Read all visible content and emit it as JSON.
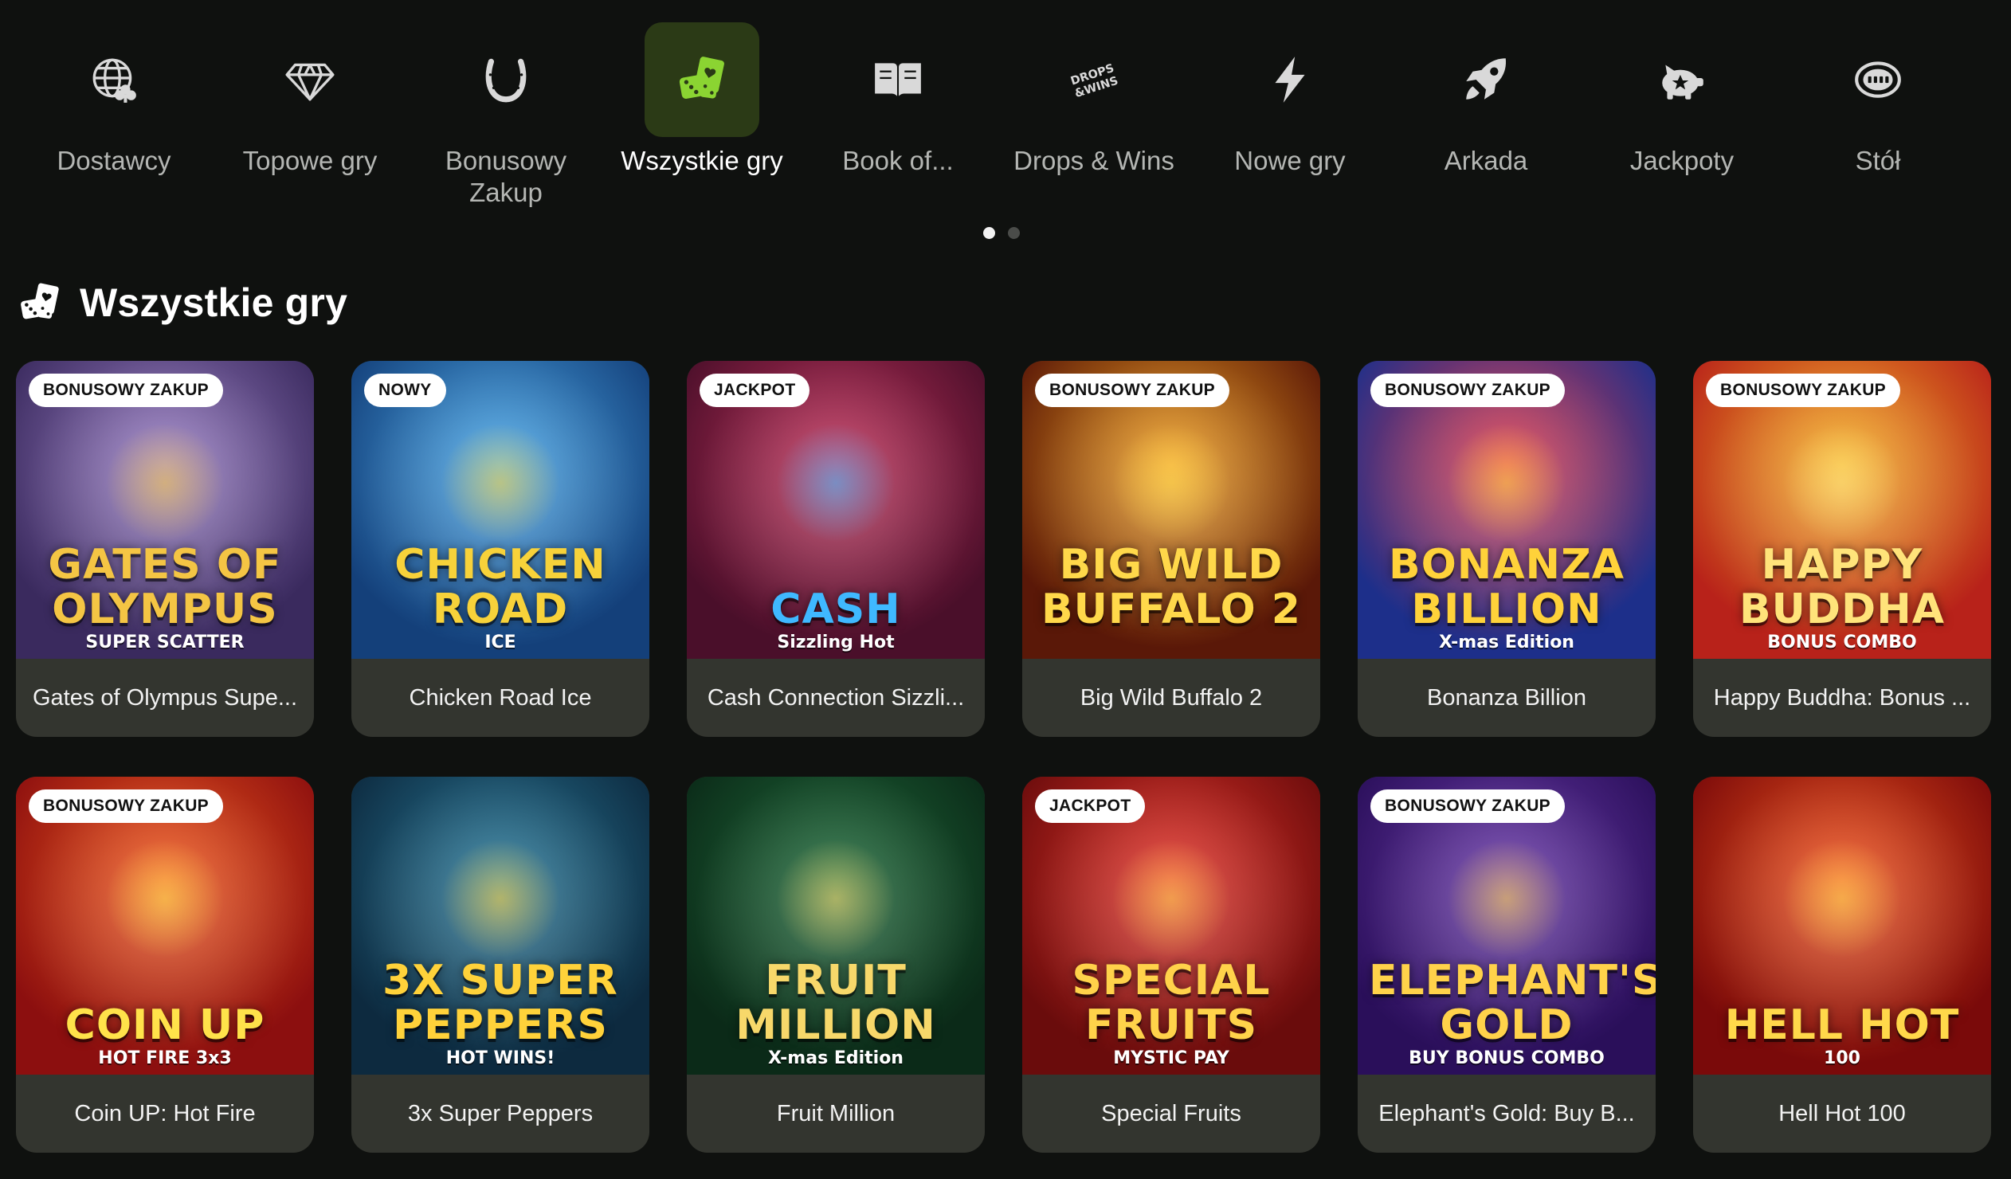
{
  "categories": [
    {
      "label": "Dostawcy",
      "icon": "globe-clubs-icon",
      "active": false
    },
    {
      "label": "Topowe gry",
      "icon": "diamond-icon",
      "active": false
    },
    {
      "label": "Bonusowy\nZakup",
      "icon": "horseshoe-icon",
      "active": false
    },
    {
      "label": "Wszystkie gry",
      "icon": "cards-dice-icon",
      "active": true
    },
    {
      "label": "Book of...",
      "icon": "book-icon",
      "active": false
    },
    {
      "label": "Drops & Wins",
      "icon": "drops-wins-icon",
      "active": false
    },
    {
      "label": "Nowe gry",
      "icon": "lightning-icon",
      "active": false
    },
    {
      "label": "Arkada",
      "icon": "rocket-icon",
      "active": false
    },
    {
      "label": "Jackpoty",
      "icon": "piggy-bank-icon",
      "active": false
    },
    {
      "label": "Stół",
      "icon": "table-icon",
      "active": false
    }
  ],
  "pagination": {
    "pages": 2,
    "current": 1
  },
  "section": {
    "title": "Wszystkie gry",
    "icon": "cards-dice-icon"
  },
  "colors": {
    "accent": "#8bd432",
    "active_bg": "#2b3a16",
    "background": "#0f110f",
    "card_footer": "#33352f"
  },
  "games": [
    {
      "name": "Gates of Olympus Supe...",
      "badge": "BONUSOWY ZAKUP",
      "art_text": "Gates of\nOlympus",
      "art_sub": "SUPER SCATTER",
      "bg1": "#9a7fc4",
      "bg2": "#3a2a5e",
      "text_color": "#f4c544"
    },
    {
      "name": "Chicken Road Ice",
      "badge": "NOWY",
      "art_text": "Chicken\nRoad",
      "art_sub": "ICE",
      "bg1": "#4aa8e8",
      "bg2": "#14407a",
      "text_color": "#f7d23a"
    },
    {
      "name": "Cash Connection Sizzli...",
      "badge": "JACKPOT",
      "art_text": "Cash",
      "art_sub": "Sizzling Hot",
      "bg1": "#c0315a",
      "bg2": "#4a0f2a",
      "text_color": "#3fb8ff"
    },
    {
      "name": "Big Wild Buffalo 2",
      "badge": "BONUSOWY ZAKUP",
      "art_text": "Big Wild\nBuffalo 2",
      "art_sub": "",
      "bg1": "#f0a020",
      "bg2": "#5a1808",
      "text_color": "#ffd84a"
    },
    {
      "name": "Bonanza Billion",
      "badge": "BONUSOWY ZAKUP",
      "art_text": "Bonanza\nBillion",
      "art_sub": "X-mas Edition",
      "bg1": "#e23a4a",
      "bg2": "#1d2f8a",
      "text_color": "#ffd23a"
    },
    {
      "name": "Happy Buddha: Bonus ...",
      "badge": "BONUSOWY ZAKUP",
      "art_text": "Happy\nBuddha",
      "art_sub": "BONUS COMBO",
      "bg1": "#f5b324",
      "bg2": "#b8221a",
      "text_color": "#ffe37a"
    },
    {
      "name": "Coin UP: Hot Fire",
      "badge": "BONUSOWY ZAKUP",
      "art_text": "Coin Up",
      "art_sub": "HOT FIRE 3x3",
      "bg1": "#f05a1e",
      "bg2": "#8c0f0f",
      "text_color": "#ffe24a"
    },
    {
      "name": "3x Super Peppers",
      "badge": "",
      "art_text": "3x Super\nPeppers",
      "art_sub": "HOT WINS!",
      "bg1": "#2a7a9a",
      "bg2": "#0d2a3f",
      "text_color": "#ffd23a"
    },
    {
      "name": "Fruit Million",
      "badge": "",
      "art_text": "Fruit\nMillion",
      "art_sub": "X-mas Edition",
      "bg1": "#1f6a3a",
      "bg2": "#0b2a18",
      "text_color": "#f7d86a"
    },
    {
      "name": "Special Fruits",
      "badge": "JACKPOT",
      "art_text": "Special\nFruits",
      "art_sub": "MYSTIC PAY",
      "bg1": "#e4342a",
      "bg2": "#6a0c0c",
      "text_color": "#ffd24a"
    },
    {
      "name": "Elephant's Gold: Buy B...",
      "badge": "BONUSOWY ZAKUP",
      "art_text": "Elephant's\nGold",
      "art_sub": "BUY BONUS COMBO",
      "bg1": "#6a3aa8",
      "bg2": "#2a0f5a",
      "text_color": "#ffd24a"
    },
    {
      "name": "Hell Hot 100",
      "badge": "",
      "art_text": "Hell Hot",
      "art_sub": "100",
      "bg1": "#f0541e",
      "bg2": "#7a0a0a",
      "text_color": "#ffd84a"
    }
  ]
}
